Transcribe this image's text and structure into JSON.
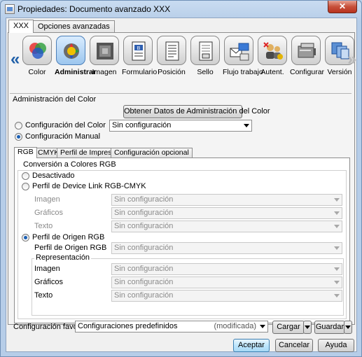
{
  "window": {
    "title": "Propiedades: Documento avanzado XXX",
    "close_glyph": "✕"
  },
  "top_tabs": [
    "XXX",
    "Opciones avanzadas"
  ],
  "nav": {
    "left_glyph": "«",
    "right_glyph": "»"
  },
  "toolbar": [
    {
      "label": "Color",
      "icon": "color-circles-icon"
    },
    {
      "label": "Administrar",
      "icon": "gear-color-icon"
    },
    {
      "label": "Imagen",
      "icon": "image-icon"
    },
    {
      "label": "Formulario",
      "icon": "form-icon"
    },
    {
      "label": "Posición",
      "icon": "position-icon"
    },
    {
      "label": "Sello",
      "icon": "stamp-icon"
    },
    {
      "label": "Flujo trabajo",
      "icon": "workflow-icon"
    },
    {
      "label": "Autent.",
      "icon": "auth-icon"
    },
    {
      "label": "Configurar",
      "icon": "configure-icon"
    },
    {
      "label": "Versión",
      "icon": "version-icon"
    }
  ],
  "color_admin": {
    "section_title": "Administración del Color",
    "get_data_button": "Obtener Datos de Administración del Color",
    "radio_color_config": "Configuración del Color",
    "color_config_value": "Sin configuración",
    "radio_manual": "Configuración Manual"
  },
  "sub_tabs": [
    "RGB",
    "CMYK",
    "Perfil de Impresora",
    "Configuración opcional"
  ],
  "rgb": {
    "group_title": "Conversión a Colores RGB",
    "opt_disabled": "Desactivado",
    "opt_devicelink": "Perfil de Device Link RGB-CMYK",
    "devicelink_rows": [
      {
        "label": "Imagen",
        "value": "Sin configuración"
      },
      {
        "label": "Gráficos",
        "value": "Sin configuración"
      },
      {
        "label": "Texto",
        "value": "Sin configuración"
      }
    ],
    "opt_origin": "Perfil de Origen RGB",
    "origin_label": "Perfil de Origen RGB",
    "origin_value": "Sin configuración",
    "rendering_title": "Representación",
    "rendering_rows": [
      {
        "label": "Imagen",
        "value": "Sin configuración"
      },
      {
        "label": "Gráficos",
        "value": "Sin configuración"
      },
      {
        "label": "Texto",
        "value": "Sin configuración"
      }
    ]
  },
  "favorites": {
    "label": "Configuración favorita",
    "value": "Configuraciones predefinidos",
    "modified": "(modificada)",
    "load": "Cargar",
    "save": "Guardar"
  },
  "footer": {
    "ok": "Aceptar",
    "cancel": "Cancelar",
    "help": "Ayuda"
  }
}
